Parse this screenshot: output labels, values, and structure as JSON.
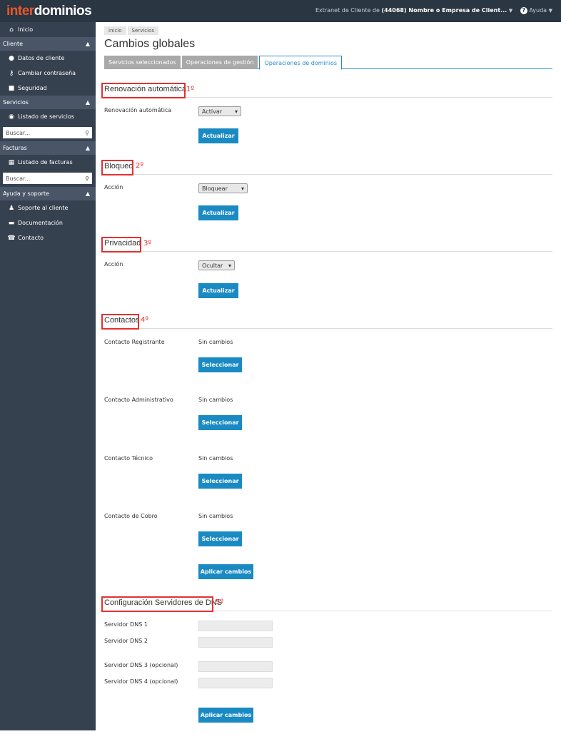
{
  "brand": {
    "part1": "inter",
    "part2": "dominios"
  },
  "topbar": {
    "extranet_label": "Extranet de Cliente de",
    "account": "(44068) Nombre o Empresa de Client...",
    "help": "Ayuda"
  },
  "sidebar": {
    "home": "Inicio",
    "sections": [
      {
        "title": "Cliente",
        "items": [
          "Datos de cliente",
          "Cambiar contraseña",
          "Seguridad"
        ]
      },
      {
        "title": "Servicios",
        "items": [
          "Listado de servicios"
        ],
        "search": "Buscar..."
      },
      {
        "title": "Facturas",
        "items": [
          "Listado de facturas"
        ],
        "search": "Buscar..."
      },
      {
        "title": "Ayuda y soporte",
        "items": [
          "Soporte al cliente",
          "Documentación",
          "Contacto"
        ]
      }
    ]
  },
  "breadcrumb": [
    "Inicio",
    "Servicios"
  ],
  "page_title": "Cambios globales",
  "tabs": [
    "Servicios seleccionados",
    "Operaciones de gestión",
    "Operaciones de dominios"
  ],
  "renovacion": {
    "title": "Renovación automática",
    "num": "1º",
    "label": "Renovación automática",
    "value": "Activar",
    "button": "Actualizar"
  },
  "bloqueo": {
    "title": "Bloqueo",
    "num": "2º",
    "label": "Acción",
    "value": "Bloquear",
    "button": "Actualizar"
  },
  "privacidad": {
    "title": "Privacidad",
    "num": "3º",
    "label": "Acción",
    "value": "Ocultar",
    "button": "Actualizar"
  },
  "contactos": {
    "title": "Contactos",
    "num": "4º",
    "rows": [
      {
        "label": "Contacto Registrante",
        "value": "Sin cambios",
        "button": "Seleccionar"
      },
      {
        "label": "Contacto Administrativo",
        "value": "Sin cambios",
        "button": "Seleccionar"
      },
      {
        "label": "Contacto Técnico",
        "value": "Sin cambios",
        "button": "Seleccionar"
      },
      {
        "label": "Contacto de Cobro",
        "value": "Sin cambios",
        "button": "Seleccionar"
      }
    ],
    "apply": "Aplicar cambios"
  },
  "dns": {
    "title": "Configuración Servidores de DNS",
    "num": "5º",
    "labels": [
      "Servidor DNS 1",
      "Servidor DNS 2",
      "Servidor DNS 3 (opcional)",
      "Servidor DNS 4 (opcional)"
    ],
    "apply": "Aplicar cambios"
  }
}
